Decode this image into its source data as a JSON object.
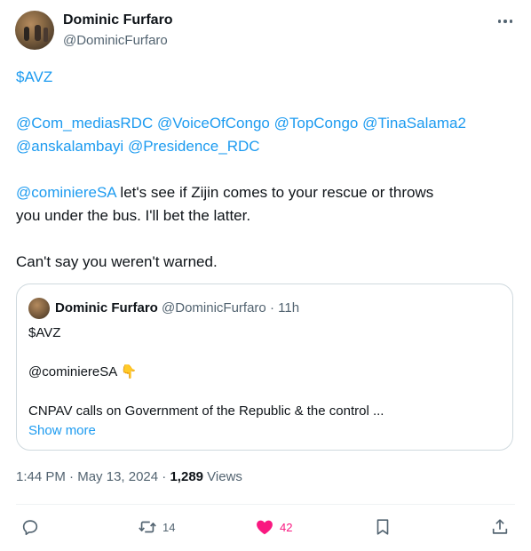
{
  "author": {
    "name": "Dominic Furfaro",
    "handle": "@DominicFurfaro"
  },
  "tweet": {
    "cashtag": "$AVZ",
    "mentions_line1": [
      "@Com_mediasRDC",
      "@VoiceOfCongo",
      "@TopCongo",
      "@TinaSalama2"
    ],
    "mentions_line2": [
      "@anskalambayi",
      "@Presidence_RDC"
    ],
    "reply_mention": "@cominiereSA",
    "reply_text_line1": " let's see if Zijin comes to your rescue or throws",
    "reply_text_line2": "you under the bus. I'll bet the latter.",
    "closing": "Can't say you weren't warned."
  },
  "quote": {
    "name": "Dominic Furfaro",
    "handle": "@DominicFurfaro",
    "separator": "·",
    "time": "11h",
    "line1": "$AVZ",
    "line2": "@cominiereSA 👇",
    "line3": "CNPAV calls on Government of the Republic & the control ...",
    "show_more": "Show more"
  },
  "meta": {
    "time": "1:44 PM",
    "sep1": " · ",
    "date": "May 13, 2024",
    "sep2": " · ",
    "views_count": "1,289",
    "views_label": " Views"
  },
  "actions": {
    "reply_count": "",
    "retweet_count": "14",
    "like_count": "42",
    "bookmark_count": "",
    "share_count": ""
  },
  "colors": {
    "accent": "#1d9bf0",
    "like": "#f91880",
    "secondary_text": "#536471",
    "border": "#cfd9de"
  },
  "icons": [
    "more-icon",
    "reply-icon",
    "retweet-icon",
    "heart-icon",
    "bookmark-icon",
    "share-icon"
  ]
}
